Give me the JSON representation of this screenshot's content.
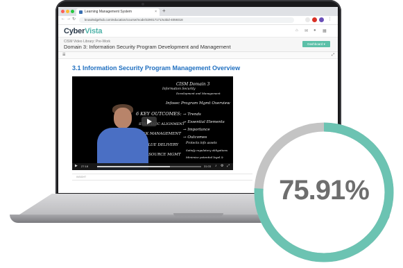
{
  "browser": {
    "tab_title": "Learning Management System",
    "tab_close": "×",
    "new_tab": "+",
    "url": "knowledgehub.com/education/course/mode/329017171/sobid-4059318",
    "back_icon": "←",
    "forward_icon": "→",
    "reload_icon": "↻"
  },
  "app": {
    "logo_main": "Cyber",
    "logo_accent": "Vista",
    "breadcrumb": "CISM Video Library: Pre-Work",
    "domain_title": "Domain 3: Information Security Program Development and Management",
    "dashboard_button": "Dashboard"
  },
  "lesson": {
    "title": "3.1 Information Security Program Management Overview"
  },
  "video": {
    "board": {
      "header1": "CISM Domain 3",
      "header2": "Information Security",
      "header3": "Development and Management",
      "topic": "Infosec Program Mgmt Overview",
      "outcomes": "6 KEY OUTCOMES:",
      "item_trends": "Trends",
      "item_elements": "Essential Elements",
      "item_importance": "Importance",
      "item_outcomes": "Outcomes",
      "alignment": "STRATEGIC ALIGNMENT",
      "risk": "RISK MANAGEMENT",
      "value": "VALUE DELIVERY",
      "resource": "RESOURCE MGMT",
      "protects": "Protects info assets",
      "satisfy": "Satisfy regulatory obligations",
      "minimize": "Minimize potential legal &"
    },
    "time_current": "27:18",
    "time_total": "31:03",
    "progress_fraction": 0.7
  },
  "below_label": "INSIGHT",
  "gauge": {
    "value_text": "75.91%",
    "fraction": 0.7591,
    "track_color": "#c4c4c4",
    "fill_color": "#6cc3b2"
  }
}
